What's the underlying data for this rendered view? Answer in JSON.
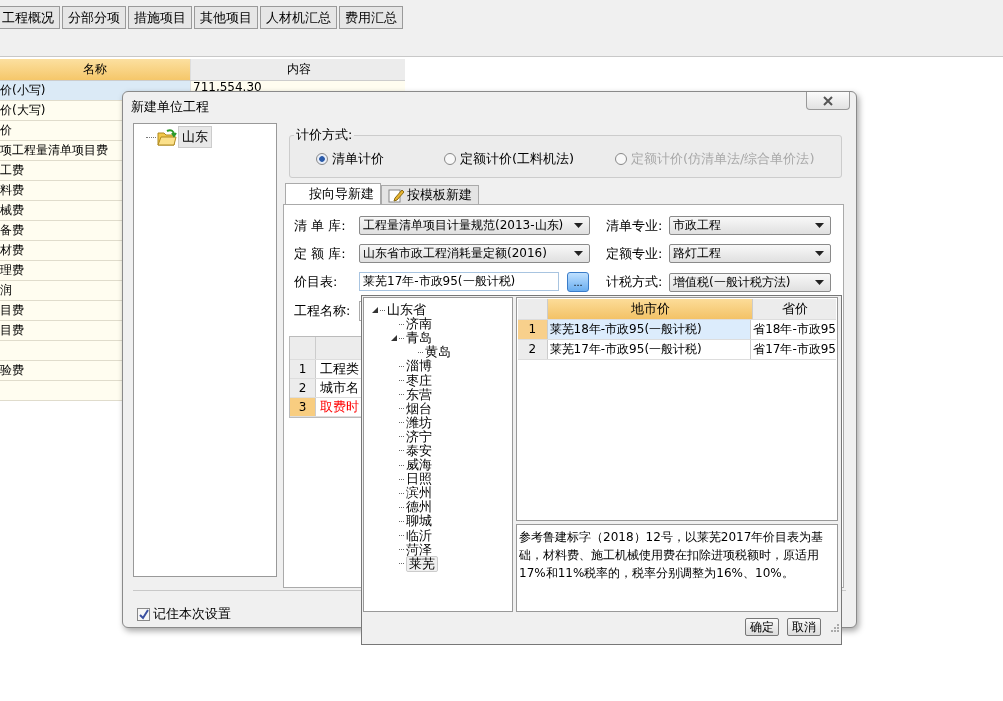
{
  "main_tabs": [
    {
      "label": "工程概况",
      "selected": false
    },
    {
      "label": "分部分项",
      "selected": false
    },
    {
      "label": "措施项目",
      "selected": false
    },
    {
      "label": "其他项目",
      "selected": false
    },
    {
      "label": "人材机汇总",
      "selected": false
    },
    {
      "label": "费用汇总",
      "selected": false
    }
  ],
  "summary_table": {
    "columns": [
      {
        "label": "名称",
        "selected": true
      },
      {
        "label": "内容",
        "selected": false
      }
    ],
    "rows": [
      {
        "name": "价(小写)",
        "value": "711,554.30",
        "selected": true
      },
      {
        "name": "价(大写)",
        "selected": false
      },
      {
        "name": "价",
        "selected": false
      },
      {
        "name": "项工程量清单项目费",
        "selected": false
      },
      {
        "name": "工费",
        "selected": false
      },
      {
        "name": "料费",
        "selected": false
      },
      {
        "name": "械费",
        "selected": false
      },
      {
        "name": "备费",
        "selected": false
      },
      {
        "name": "材费",
        "selected": false
      },
      {
        "name": "理费",
        "selected": false
      },
      {
        "name": "润",
        "selected": false
      },
      {
        "name": "目费",
        "selected": false
      },
      {
        "name": "目费",
        "selected": false
      },
      {
        "selected": false
      },
      {
        "name": "验费",
        "selected": false
      },
      {
        "selected": false
      }
    ]
  },
  "dialog": {
    "title": "新建单位工程",
    "region_tree": [
      {
        "label": "山东",
        "selected": true
      }
    ],
    "pricing": {
      "label": "计价方式:",
      "options": [
        {
          "label": "清单计价",
          "selected": true,
          "disabled": false
        },
        {
          "label": "定额计价(工料机法)",
          "selected": false,
          "disabled": false
        },
        {
          "label": "定额计价(仿清单法/综合单价法)",
          "selected": false,
          "disabled": true
        }
      ]
    },
    "tabs": [
      {
        "label": "按向导新建",
        "selected": true
      },
      {
        "label": "按模板新建",
        "selected": false
      }
    ],
    "fields": [
      {
        "label": "清 单 库:",
        "kind": "select",
        "value": "工程量清单项目计量规范(2013-山东)"
      },
      {
        "label": "清单专业:",
        "kind": "select",
        "value": "市政工程"
      },
      {
        "label": "定 额 库:",
        "kind": "select",
        "value": "山东省市政工程消耗量定额(2016)"
      },
      {
        "label": "定额专业:",
        "kind": "select",
        "value": "路灯工程"
      },
      {
        "label": "价目表:",
        "kind": "browse",
        "value": "莱芜17年-市政95(一般计税)",
        "button": "..."
      },
      {
        "label": "计税方式:",
        "kind": "select",
        "value": "增值税(一般计税方法)"
      },
      {
        "label": "工程名称:",
        "kind": "text"
      }
    ],
    "params": [
      {
        "no": "1",
        "name": "工程类",
        "selected": false
      },
      {
        "no": "2",
        "name": "城市名",
        "selected": false
      },
      {
        "no": "3",
        "name": "取费时",
        "selected": true
      }
    ],
    "remember": {
      "label": "记住本次设置",
      "checked": true
    }
  },
  "popup": {
    "tree": [
      {
        "label": "山东省",
        "expanded": true,
        "selected": false,
        "children": [
          {
            "label": "济南",
            "selected": false
          },
          {
            "label": "青岛",
            "expanded": true,
            "selected": false,
            "children": [
              {
                "label": "黄岛",
                "selected": false
              }
            ]
          },
          {
            "label": "淄博",
            "selected": false
          },
          {
            "label": "枣庄",
            "selected": false
          },
          {
            "label": "东营",
            "selected": false
          },
          {
            "label": "烟台",
            "selected": false
          },
          {
            "label": "潍坊",
            "selected": false
          },
          {
            "label": "济宁",
            "selected": false
          },
          {
            "label": "泰安",
            "selected": false
          },
          {
            "label": "威海",
            "selected": false
          },
          {
            "label": "日照",
            "selected": false
          },
          {
            "label": "滨州",
            "selected": false
          },
          {
            "label": "德州",
            "selected": false
          },
          {
            "label": "聊城",
            "selected": false
          },
          {
            "label": "临沂",
            "selected": false
          },
          {
            "label": "菏泽",
            "selected": false
          },
          {
            "label": "莱芜",
            "selected": true
          }
        ]
      }
    ],
    "price_table": {
      "columns": [
        {
          "label": "地市价",
          "selected": true
        },
        {
          "label": "省价",
          "selected": false
        }
      ],
      "rows": [
        {
          "no": "1",
          "city": "莱芜18年-市政95(一般计税)",
          "province": "省18年-市政95",
          "selected": true
        },
        {
          "no": "2",
          "city": "莱芜17年-市政95(一般计税)",
          "province": "省17年-市政95",
          "selected": false
        }
      ]
    },
    "note": "参考鲁建标字（2018）12号，以莱芜2017年价目表为基础，材料费、施工机械使用费在扣除进项税额时，原适用17%和11%税率的，税率分别调整为16%、10%。",
    "buttons": [
      "确定",
      "取消"
    ]
  }
}
